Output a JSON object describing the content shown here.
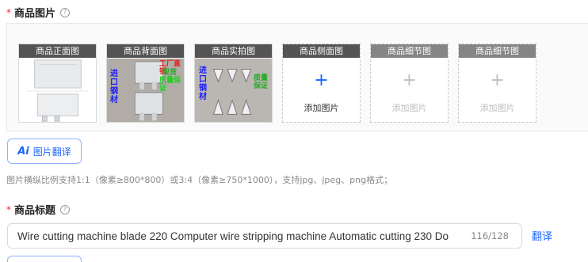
{
  "images_section": {
    "required_mark": "*",
    "label": "商品图片",
    "help_icon": "question-circle-icon",
    "slots": [
      {
        "label": "商品正面图",
        "state": "uploaded"
      },
      {
        "label": "商品背面图",
        "state": "uploaded"
      },
      {
        "label": "商品实拍图",
        "state": "uploaded"
      },
      {
        "label": "商品侧面图",
        "state": "empty-active",
        "add_text": "添加图片"
      },
      {
        "label": "商品细节图",
        "state": "empty-disabled",
        "add_text": "添加图片"
      },
      {
        "label": "商品细节图",
        "state": "empty-disabled",
        "add_text": "添加图片"
      }
    ],
    "photo_overlay_text": {
      "back": [
        "进口",
        "钢材",
        "工厂直销",
        "现货",
        "质量保证"
      ],
      "real": [
        "进口",
        "钢材",
        "质量保证"
      ]
    }
  },
  "image_translate_button": {
    "icon": "ai-icon",
    "icon_text": "Ai",
    "label": "图片翻译"
  },
  "image_hint": "图片横纵比例支持1:1（像素≥800*800）或3:4（像素≥750*1000），支持jpg、jpeg、png格式；",
  "title_section": {
    "required_mark": "*",
    "label": "商品标题",
    "help_icon": "question-circle-icon",
    "value": "Wire cutting machine blade 220 Computer wire stripping machine Automatic cutting 230 Do",
    "counter": "116/128",
    "translate_link": "翻译"
  },
  "colors": {
    "accent": "#1a66ff",
    "required": "#f5222d",
    "panel_bg": "#fafafa"
  }
}
